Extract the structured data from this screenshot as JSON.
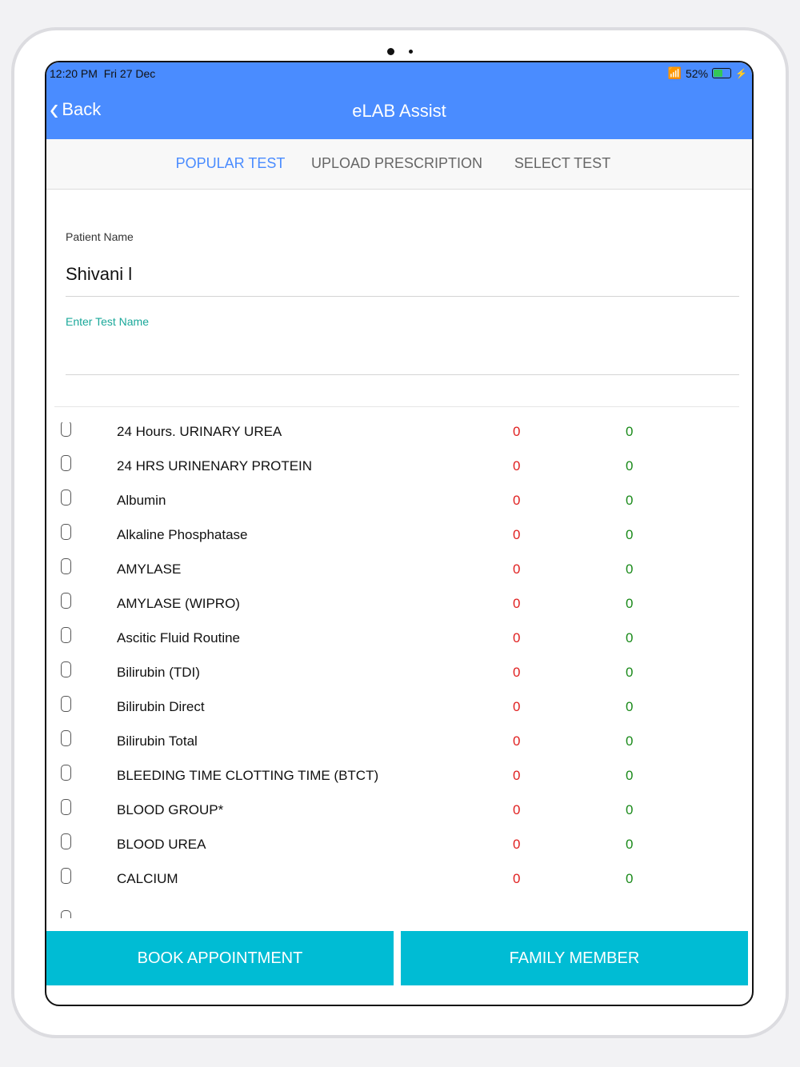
{
  "status": {
    "time": "12:20 PM",
    "date": "Fri 27 Dec",
    "battery": "52%"
  },
  "nav": {
    "back_label": "Back",
    "title": "eLAB Assist"
  },
  "tabs": [
    {
      "label": "POPULAR TEST",
      "active": true
    },
    {
      "label": "UPLOAD PRESCRIPTION",
      "active": false
    },
    {
      "label": "SELECT TEST",
      "active": false
    }
  ],
  "form": {
    "patient_label": "Patient Name",
    "patient_value": "Shivani l",
    "test_label": "Enter Test Name",
    "test_value": ""
  },
  "tests": [
    {
      "name": "24 Hours. URINARY UREA",
      "price": "0",
      "discount": "0"
    },
    {
      "name": "24 HRS URINENARY PROTEIN",
      "price": "0",
      "discount": "0"
    },
    {
      "name": "Albumin",
      "price": "0",
      "discount": "0"
    },
    {
      "name": "Alkaline Phosphatase",
      "price": "0",
      "discount": "0"
    },
    {
      "name": "AMYLASE",
      "price": "0",
      "discount": "0"
    },
    {
      "name": "AMYLASE (WIPRO)",
      "price": "0",
      "discount": "0"
    },
    {
      "name": "Ascitic Fluid Routine",
      "price": "0",
      "discount": "0"
    },
    {
      "name": "Bilirubin (TDI)",
      "price": "0",
      "discount": "0"
    },
    {
      "name": "Bilirubin Direct",
      "price": "0",
      "discount": "0"
    },
    {
      "name": "Bilirubin Total",
      "price": "0",
      "discount": "0"
    },
    {
      "name": "BLEEDING TIME CLOTTING TIME (BTCT)",
      "price": "0",
      "discount": "0"
    },
    {
      "name": "BLOOD GROUP*",
      "price": "0",
      "discount": "0"
    },
    {
      "name": "BLOOD UREA",
      "price": "0",
      "discount": "0"
    },
    {
      "name": "CALCIUM",
      "price": "0",
      "discount": "0"
    }
  ],
  "buttons": {
    "book": "BOOK APPOINTMENT",
    "family": "FAMILY MEMBER"
  },
  "colors": {
    "header": "#4a8cff",
    "button": "#00bcd4",
    "price": "#e02020",
    "discount": "#1a8a1a",
    "label": "#1aa89a"
  }
}
